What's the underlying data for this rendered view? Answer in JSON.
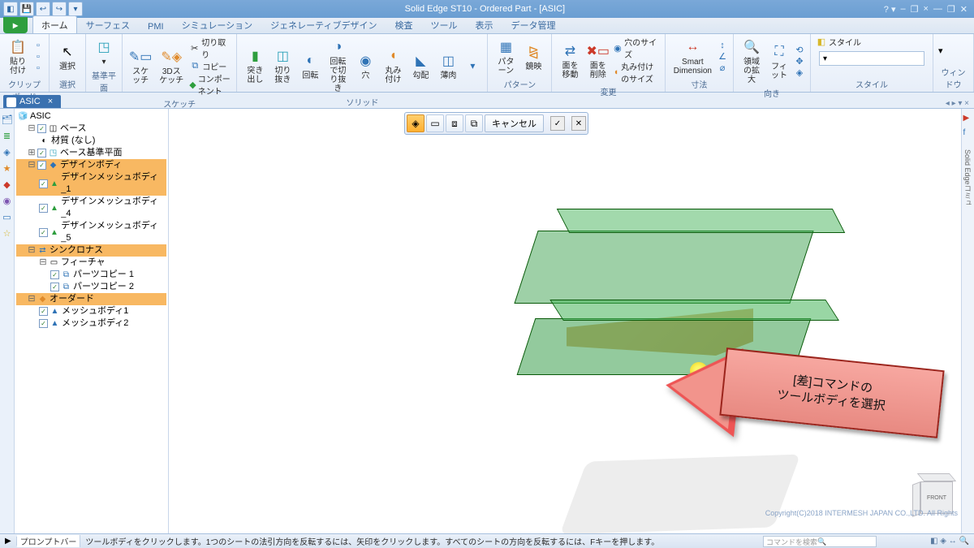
{
  "title": "Solid Edge ST10 - Ordered Part - [ASIC]",
  "qat": {
    "save": "💾",
    "undo": "↩",
    "redo": "↪",
    "more": "▾"
  },
  "win": {
    "help": "?",
    "min": "—",
    "max": "❐",
    "close": "✕",
    "min2": "–",
    "max2": "❐",
    "close2": "×"
  },
  "tabs": {
    "home": "ホーム",
    "surface": "サーフェス",
    "pmi": "PMI",
    "sim": "シミュレーション",
    "gen": "ジェネレーティブデザイン",
    "inspect": "検査",
    "tool": "ツール",
    "view": "表示",
    "data": "データ管理"
  },
  "groups": {
    "clipboard": "クリップボード",
    "select": "選択",
    "plane": "基準平面",
    "sketch": "スケッチ",
    "solid": "ソリッド",
    "pattern": "パターン",
    "modify": "変更",
    "dims": "寸法",
    "orient": "向き",
    "style": "スタイル",
    "window": "ウィンドウ"
  },
  "btn": {
    "paste": "貼り付け",
    "select": "選択",
    "sketch": "スケッチ",
    "sketch3d": "3Dスケッチ",
    "cut": "切り取り",
    "copy": "コピー",
    "component": "コンポーネント",
    "extrude": "突き出し",
    "cutout": "切り抜き",
    "revolve": "回転",
    "revcut": "回転で切り抜き",
    "hole": "穴",
    "round": "丸み付け",
    "draft": "勾配",
    "thin": "薄肉",
    "pattern": "パターン",
    "mirror": "鏡映",
    "holesize": "穴のサイズ",
    "facemove": "面を移動",
    "facedel": "面を削除",
    "roundsize": "丸み付けのサイズ",
    "smartdim": "Smart Dimension",
    "region": "領域の拡大",
    "fit": "フィット",
    "styleA": "スタイル"
  },
  "doc_tab": "ASIC",
  "doc_close": "×",
  "cmd": {
    "cancel": "キャンセル"
  },
  "tree": {
    "root": "ASIC",
    "base": "ベース",
    "mat": "材質 (なし)",
    "refplane": "ベース基準平面",
    "design": "デザインボディ",
    "dm1": "デザインメッシュボディ_1",
    "dm4": "デザインメッシュボディ_4",
    "dm5": "デザインメッシュボディ_5",
    "sync": "シンクロナス",
    "feat": "フィーチャ",
    "pc1": "パーツコピー 1",
    "pc2": "パーツコピー 2",
    "ordered": "オーダード",
    "mb1": "メッシュボディ1",
    "mb2": "メッシュボディ2"
  },
  "callout": {
    "l1": "[差]コマンドの",
    "l2": "ツールボディを選択"
  },
  "vcube": "FRONT",
  "status": {
    "rec": "▶",
    "prompt": "プロンプトバー",
    "msg": "ツールボディをクリックします。1つのシートの法引方向を反転するには、矢印をクリックします。すべてのシートの方向を反転するには、Fキーを押します。",
    "selection": "デザインメッシュボディ_1",
    "search_ph": "コマンドを検索",
    "copy": "Copyright(C)2018 INTERMESH JAPAN CO.,LTD.  All Rights"
  },
  "sidevtxt": "Solid Edgeコミュ"
}
